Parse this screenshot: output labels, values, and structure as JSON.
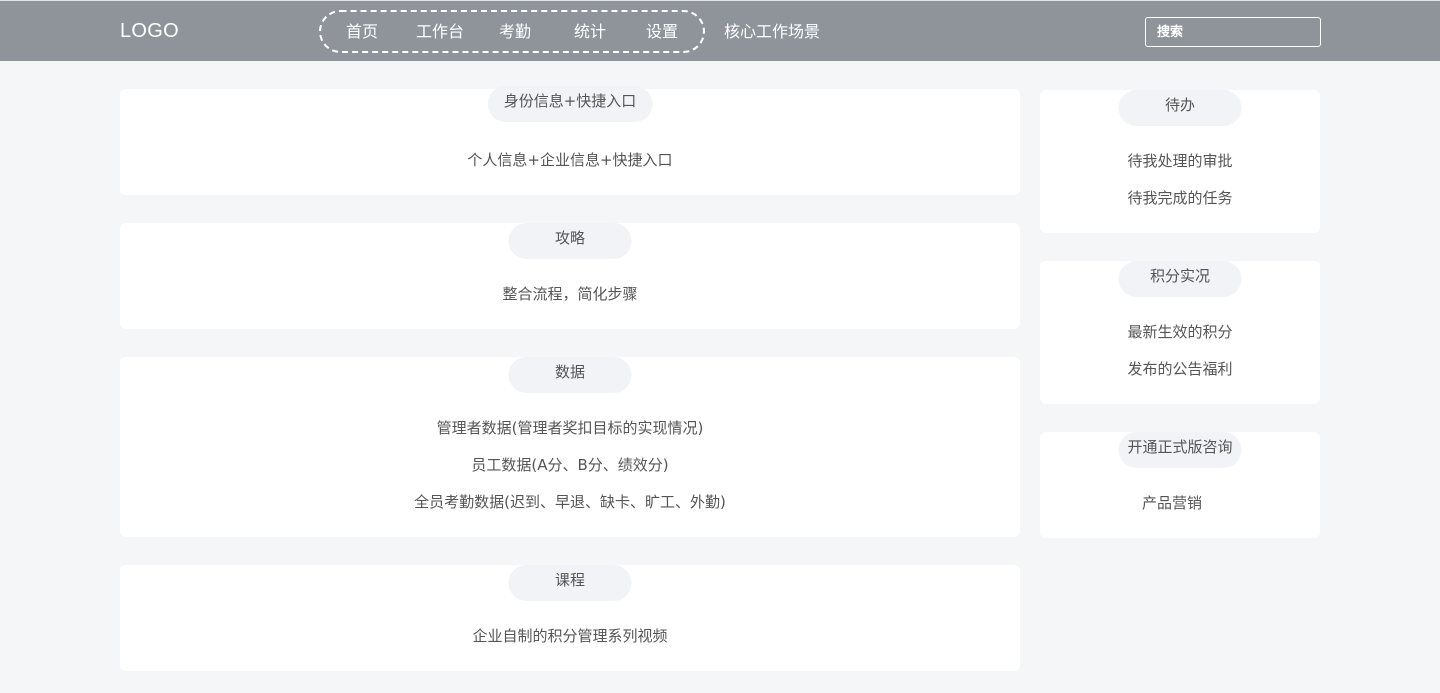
{
  "header": {
    "logo": "LOGO",
    "nav": [
      "首页",
      "工作台",
      "考勤",
      "统计",
      "设置"
    ],
    "extra_nav": "核心工作场景",
    "search_placeholder": "搜索"
  },
  "main": {
    "cards": [
      {
        "title": "身份信息+快捷入口",
        "lines": [
          "个人信息+企业信息+快捷入口"
        ]
      },
      {
        "title": "攻略",
        "lines": [
          "整合流程，简化步骤"
        ]
      },
      {
        "title": "数据",
        "lines": [
          "管理者数据(管理者奖扣目标的实现情况)",
          "员工数据(A分、B分、绩效分)",
          "全员考勤数据(迟到、早退、缺卡、旷工、外勤)"
        ]
      },
      {
        "title": "课程",
        "lines": [
          "企业自制的积分管理系列视频"
        ]
      }
    ]
  },
  "sidebar": {
    "cards": [
      {
        "title": "待办",
        "lines": [
          "待我处理的审批",
          "待我完成的任务"
        ]
      },
      {
        "title": "积分实况",
        "lines": [
          "最新生效的积分",
          "发布的公告福利"
        ]
      },
      {
        "title": "开通正式版咨询",
        "lines": [
          "产品营销"
        ]
      }
    ]
  },
  "colors": {
    "header_bg": "#8f949b",
    "page_bg": "#f5f6f8",
    "card_bg": "#ffffff",
    "pill_bg": "#f2f3f6",
    "text": "#555555"
  }
}
